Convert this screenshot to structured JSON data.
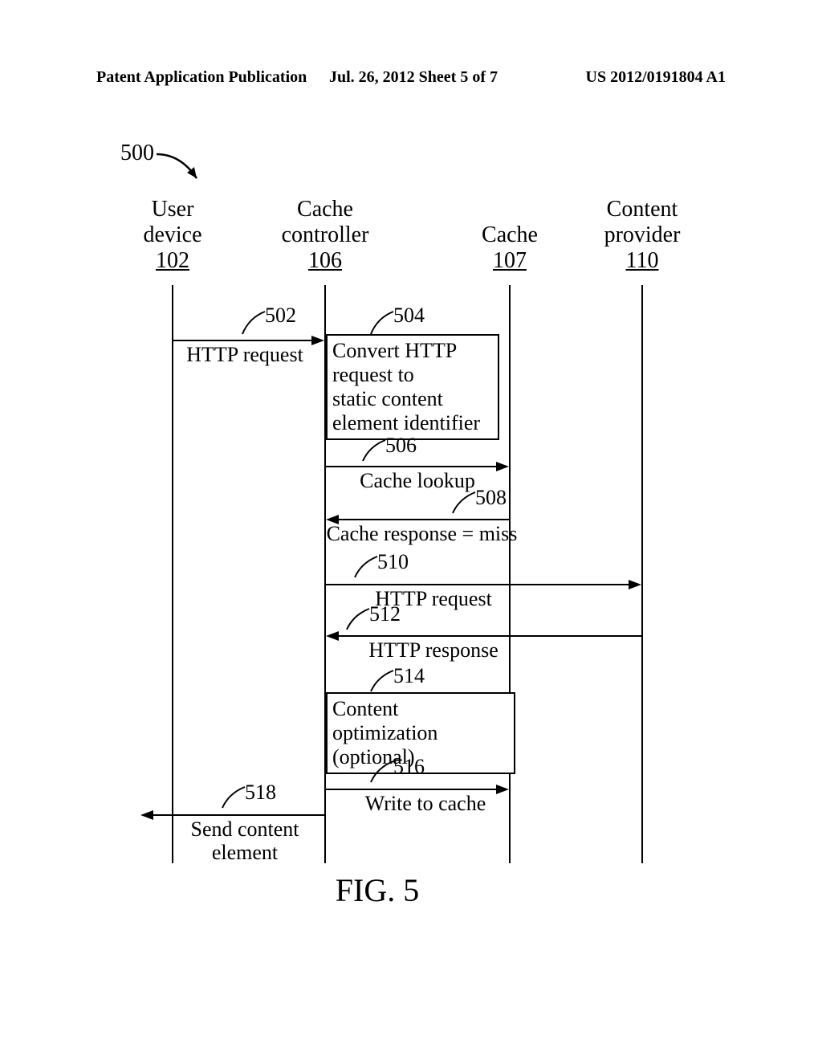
{
  "header": {
    "left": "Patent Application Publication",
    "center": "Jul. 26, 2012  Sheet 5 of 7",
    "right": "US 2012/0191804 A1"
  },
  "diagram_ref": "500",
  "lifelines": {
    "user_device": {
      "name": "User\ndevice",
      "num": "102"
    },
    "cache_controller": {
      "name": "Cache\ncontroller",
      "num": "106"
    },
    "cache": {
      "name": "Cache",
      "num": "107"
    },
    "content_provider": {
      "name": "Content\nprovider",
      "num": "110"
    }
  },
  "labels": {
    "ref502": "502",
    "msg502": "HTTP request",
    "ref504": "504",
    "box504": "Convert HTTP\nrequest to\nstatic content\nelement identifier",
    "ref506": "506",
    "msg506": "Cache lookup",
    "ref508": "508",
    "msg508": "Cache response = miss",
    "ref510": "510",
    "msg510": "HTTP request",
    "ref512": "512",
    "msg512": "HTTP response",
    "ref514": "514",
    "box514": "Content optimization\n(optional)",
    "ref516": "516",
    "msg516": "Write to cache",
    "ref518": "518",
    "msg518": "Send content\nelement"
  },
  "figure_caption": "FIG. 5"
}
